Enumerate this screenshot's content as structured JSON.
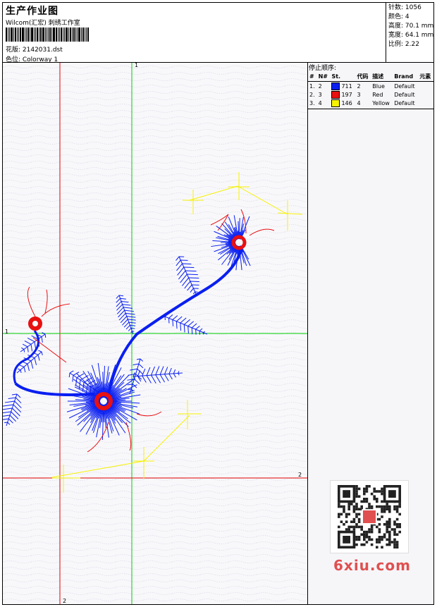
{
  "header": {
    "title": "生产作业图",
    "company": "Wilcom(汇宏) 刺绣工作室",
    "pattern": "花版: 2142031.dst",
    "colorway": "色位: Colorway 1"
  },
  "stats": {
    "stitches": "针数: 1056",
    "colors": "颜色: 4",
    "height": "高度: 70.1 mm",
    "width": "宽度: 64.1 mm",
    "scale": "比例: 2.22"
  },
  "stop_sequence": {
    "title": "停止顺序:",
    "headers": [
      "#",
      "N#",
      "St.",
      "代码",
      "描述",
      "Brand",
      "元素"
    ],
    "rows": [
      {
        "idx": "1.",
        "n": "2",
        "color": "#0a1ff0",
        "st": "711",
        "code": "2",
        "desc": "Blue",
        "brand": "Default"
      },
      {
        "idx": "2.",
        "n": "3",
        "color": "#e81010",
        "st": "197",
        "code": "3",
        "desc": "Red",
        "brand": "Default"
      },
      {
        "idx": "3.",
        "n": "4",
        "color": "#f7f200",
        "st": "146",
        "code": "4",
        "desc": "Yellow",
        "brand": "Default"
      }
    ]
  },
  "guides": {
    "vertical_top": "1",
    "horizontal_left": "1",
    "horizontal_right": "2",
    "vertical_bottom": "2"
  },
  "watermark": "6xiu.com",
  "colors": {
    "blue": "#0a1ff0",
    "red": "#e81010",
    "yellow": "#f7f200",
    "guide_green": "#00d000",
    "guide_red": "#e00000"
  }
}
